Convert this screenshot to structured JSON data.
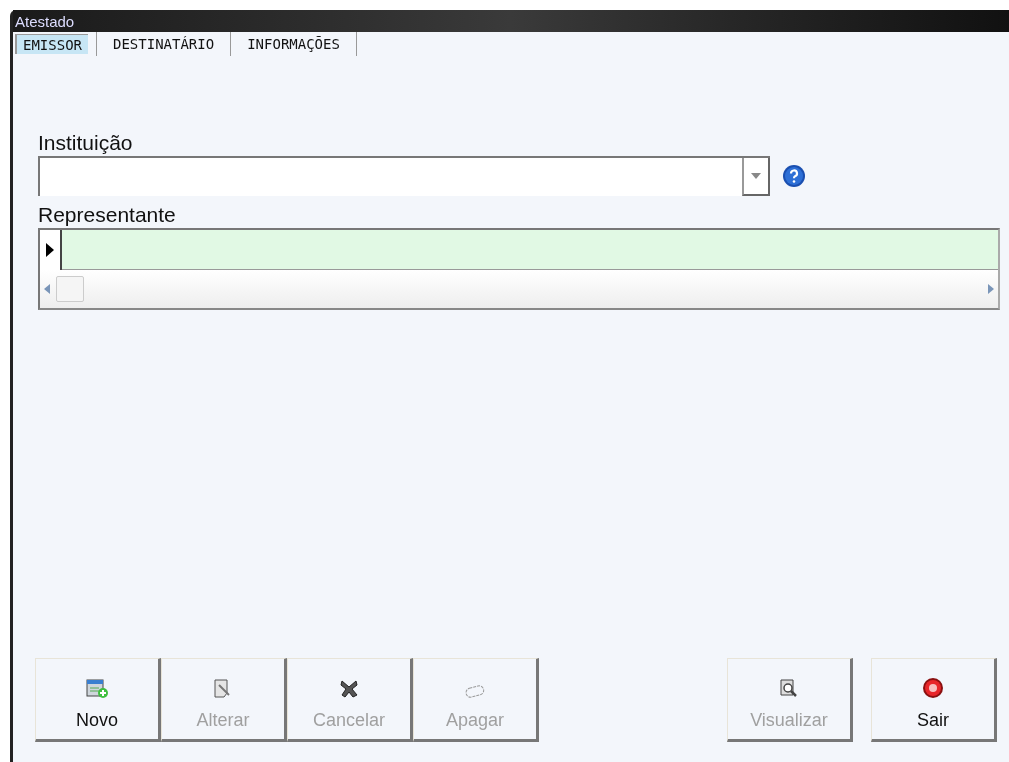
{
  "window": {
    "title": "Atestado"
  },
  "tabs": [
    {
      "label": "EMISSOR",
      "selected": true
    },
    {
      "label": "DESTINATÁRIO",
      "selected": false
    },
    {
      "label": "INFORMAÇÕES",
      "selected": false
    }
  ],
  "instituicao": {
    "label": "Instituição"
  },
  "representante": {
    "label": "Representante"
  },
  "actions_left": [
    {
      "kind": "new",
      "label": "Novo",
      "disabled": false
    },
    {
      "kind": "edit",
      "label": "Alterar",
      "disabled": true
    },
    {
      "kind": "cancel",
      "label": "Cancelar",
      "disabled": true
    },
    {
      "kind": "delete",
      "label": "Apagar",
      "disabled": true
    }
  ],
  "actions_right": [
    {
      "kind": "preview",
      "label": "Visualizar",
      "disabled": true
    },
    {
      "kind": "exit",
      "label": "Sair",
      "disabled": false
    }
  ]
}
